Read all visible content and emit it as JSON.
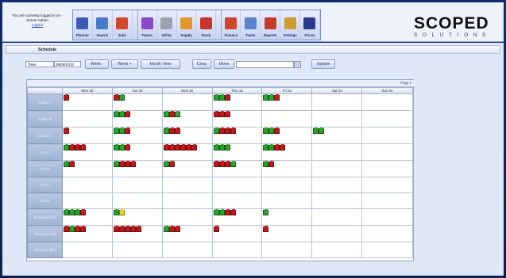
{
  "login": {
    "line1": "You are currently logged in as -",
    "line2": "Server Admin",
    "logout": "Logout"
  },
  "toolbar": [
    {
      "label": "Planner",
      "icon": "planner-icon",
      "color": "#3c5bb8"
    },
    {
      "label": "Search",
      "icon": "search-icon",
      "color": "#4a78c8"
    },
    {
      "label": "Jobs",
      "icon": "jobs-icon",
      "color": "#d24a2a"
    },
    {
      "label": "Teams",
      "icon": "teams-icon",
      "color": "#8a4ac8"
    },
    {
      "label": "Utility",
      "icon": "utility-icon",
      "color": "#9aa2b0"
    },
    {
      "label": "Supply",
      "icon": "supply-icon",
      "color": "#e0962a"
    },
    {
      "label": "Stock",
      "icon": "stock-icon",
      "color": "#c8362a"
    },
    {
      "label": "Finance",
      "icon": "finance-icon",
      "color": "#d0422a"
    },
    {
      "label": "Tasks",
      "icon": "tasks-icon",
      "color": "#5a82d0"
    },
    {
      "label": "Reports",
      "icon": "reports-icon",
      "color": "#c83a2a"
    },
    {
      "label": "Settings",
      "icon": "settings-icon",
      "color": "#c8a02a"
    },
    {
      "label": "Prices",
      "icon": "prices-icon",
      "color": "#2a3a8a"
    }
  ],
  "logo": {
    "big": "SCOPED",
    "small": "SOLUTIONS"
  },
  "schedule_title": "Schedule",
  "controls": {
    "view": "Time",
    "date": "28/08/2013",
    "week_back": "Week -",
    "week_fwd": "Week +",
    "month_view": "Month View",
    "clear": "Clear",
    "move": "Move",
    "update": "Update"
  },
  "pager": "Page 1",
  "days": [
    "Mon 28",
    "Tue 29",
    "Wed 30",
    "Thur 31",
    "Fri 02",
    "Sat 03",
    "Sun 04"
  ],
  "rows": [
    {
      "name": "Cavity A",
      "cells": [
        [
          "r"
        ],
        [
          "r",
          "g"
        ],
        [],
        [
          "g",
          "g",
          "r"
        ],
        [
          "g",
          "g",
          "r"
        ],
        [],
        []
      ]
    },
    {
      "name": "Cavity B",
      "cells": [
        [],
        [
          "g",
          "g",
          "r"
        ],
        [
          "g",
          "r",
          "g"
        ],
        [
          "r",
          "r",
          "r"
        ],
        [],
        [],
        []
      ]
    },
    {
      "name": "Cavity C",
      "cells": [
        [
          "r"
        ],
        [
          "g",
          "g",
          "r"
        ],
        [
          "g",
          "r",
          "r"
        ],
        [
          "g",
          "r",
          "r",
          "r"
        ],
        [
          "g",
          "g",
          "r"
        ],
        [
          "g",
          "g"
        ],
        []
      ]
    },
    {
      "name": "Loft A",
      "cells": [
        [
          "g",
          "r",
          "r",
          "r"
        ],
        [
          "g",
          "g",
          "r"
        ],
        [
          "r",
          "r",
          "r",
          "r",
          "r",
          "r"
        ],
        [
          "g",
          "g",
          "g"
        ],
        [
          "g",
          "g",
          "r",
          "r"
        ],
        [],
        []
      ]
    },
    {
      "name": "Loft B",
      "cells": [
        [
          "g",
          "r"
        ],
        [
          "g",
          "r",
          "r",
          "r"
        ],
        [
          "g",
          "r"
        ],
        [
          "r",
          "r",
          "r",
          "g"
        ],
        [
          "g",
          "r"
        ],
        [],
        []
      ]
    },
    {
      "name": "Loft C",
      "cells": [
        [],
        [],
        [],
        [],
        [],
        [],
        []
      ]
    },
    {
      "name": "Loft D",
      "cells": [
        [],
        [],
        [],
        [],
        [],
        [],
        []
      ]
    },
    {
      "name": "Surveyor (CH)",
      "cells": [
        [
          "g",
          "g",
          "g",
          "r"
        ],
        [
          "g",
          "y"
        ],
        [],
        [
          "g",
          "g",
          "r",
          "r"
        ],
        [
          "g"
        ],
        [],
        []
      ]
    },
    {
      "name": "Surveyor (HB)",
      "cells": [
        [
          "r",
          "g",
          "r",
          "r"
        ],
        [
          "r",
          "r",
          "r",
          "r",
          "r"
        ],
        [
          "g",
          "r",
          "r"
        ],
        [
          "r"
        ],
        [
          "r"
        ],
        [],
        []
      ]
    },
    {
      "name": "Surveyor (BK)",
      "cells": [
        [],
        [],
        [],
        [],
        [],
        [],
        []
      ]
    }
  ]
}
